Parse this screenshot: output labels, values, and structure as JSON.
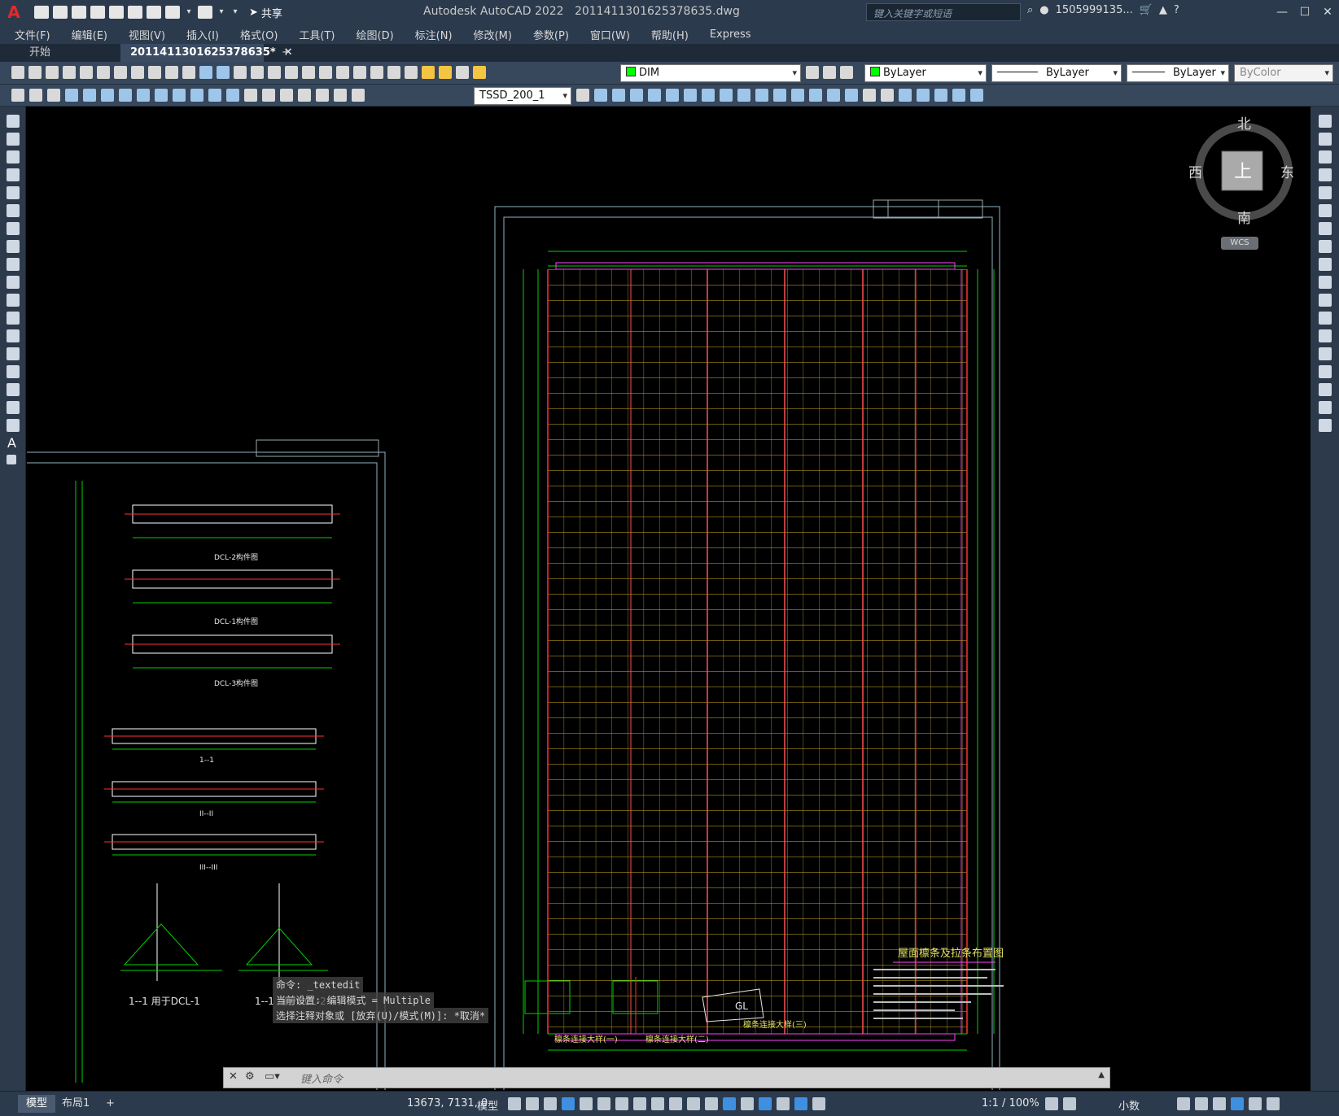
{
  "app": {
    "title": "Autodesk AutoCAD 2022",
    "filename": "2011411301625378635.dwg",
    "logo": "A",
    "share_label": "共享"
  },
  "search": {
    "placeholder": "键入关键字或短语"
  },
  "user": {
    "name": "1505999135..."
  },
  "menu": [
    "文件(F)",
    "编辑(E)",
    "视图(V)",
    "插入(I)",
    "格式(O)",
    "工具(T)",
    "绘图(D)",
    "标注(N)",
    "修改(M)",
    "参数(P)",
    "窗口(W)",
    "帮助(H)",
    "Express"
  ],
  "tabs": {
    "start": "开始",
    "active": "2011411301625378635*",
    "close": "✕",
    "add": "+"
  },
  "props": {
    "layer": "DIM",
    "color": "ByLayer",
    "linetype": "ByLayer",
    "lineweight": "ByLayer",
    "plotstyle": "ByColor",
    "layer_color": "#00ff00"
  },
  "style_combo": "TSSD_200_1",
  "viewcube": {
    "north": "北",
    "south": "南",
    "east": "东",
    "west": "西",
    "top": "上",
    "wcs": "WCS"
  },
  "drawing": {
    "right_title": "屋面檩条及拉条布置图",
    "detail1": "檩条连接大样(一)",
    "detail2": "檩条连接大样(二)",
    "detail3": "檩条连接大样(三)",
    "gl_label": "GL",
    "left_sections": [
      "DCL-2构件图",
      "DCL-1构件图",
      "DCL-3构件图",
      "1--1",
      "II--II",
      "III--III",
      "1--1 用于DCL-1",
      "1--1 用于DCL-2"
    ]
  },
  "command": {
    "line1": "命令: _textedit",
    "line2": "当前设置: 编辑模式 = Multiple",
    "line3": "选择注释对象或 [放弃(U)/模式(M)]: *取消*",
    "placeholder": "键入命令"
  },
  "status": {
    "model_tab": "模型",
    "layout_tab": "布局1",
    "add": "+",
    "coords": "13673, 7131, 0",
    "model_btn": "模型",
    "scale": "1:1 / 100%",
    "units": "小数"
  }
}
